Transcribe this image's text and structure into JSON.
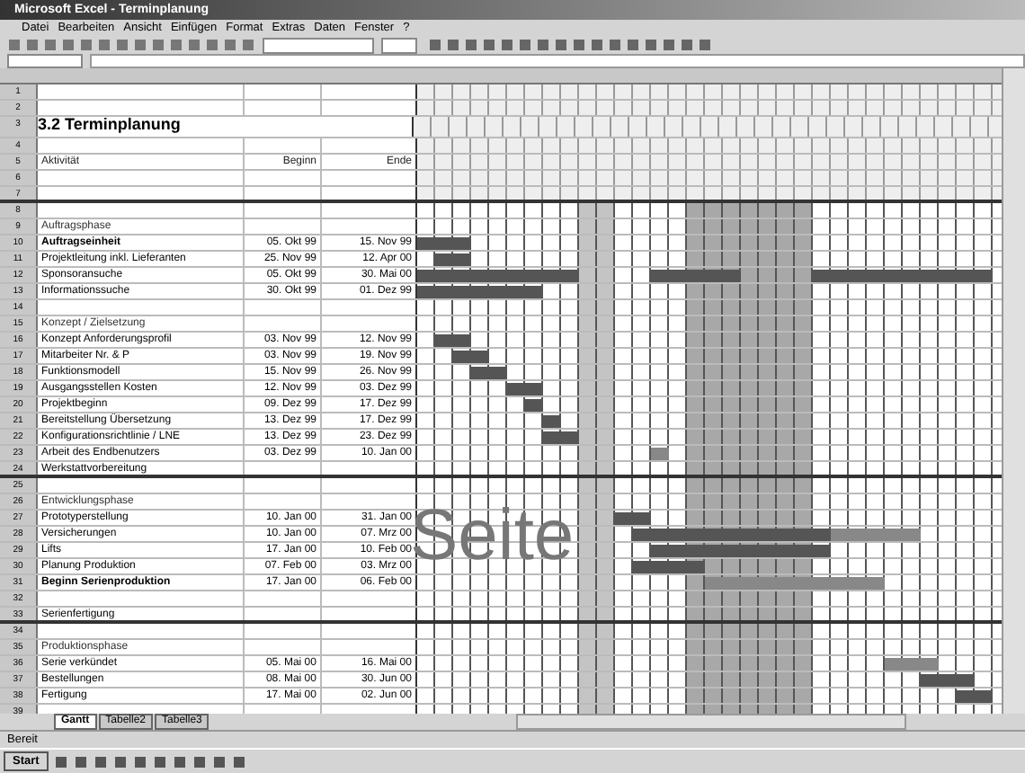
{
  "window": {
    "title": "Microsoft Excel - Terminplanung"
  },
  "menu": [
    "Datei",
    "Bearbeiten",
    "Ansicht",
    "Einfügen",
    "Format",
    "Extras",
    "Daten",
    "Fenster",
    "?"
  ],
  "sheet": {
    "title": "3.2 Terminplanung",
    "columns": [
      "Aktivität",
      "Beginn",
      "Ende"
    ],
    "page_label": "Seite",
    "rows": [
      {
        "num": "1",
        "kind": "blank"
      },
      {
        "num": "2",
        "kind": "blank"
      },
      {
        "num": "3",
        "kind": "title"
      },
      {
        "num": "4",
        "kind": "blank"
      },
      {
        "num": "5",
        "kind": "header"
      },
      {
        "num": "6",
        "kind": "blank"
      },
      {
        "num": "7",
        "kind": "section-end"
      },
      {
        "num": "8",
        "kind": "blank"
      },
      {
        "num": "9",
        "kind": "group",
        "activity": "Auftragsphase"
      },
      {
        "num": "10",
        "kind": "milestone",
        "activity": "Auftragseinheit",
        "start": "05. Okt 99",
        "end": "15. Nov 99"
      },
      {
        "num": "11",
        "kind": "task",
        "activity": "Projektleitung inkl. Lieferanten",
        "start": "25. Nov 99",
        "end": "12. Apr 00"
      },
      {
        "num": "12",
        "kind": "task",
        "activity": "Sponsoransuche",
        "start": "05. Okt 99",
        "end": "30. Mai 00"
      },
      {
        "num": "13",
        "kind": "task",
        "activity": "Informationssuche",
        "start": "30. Okt 99",
        "end": "01. Dez 99"
      },
      {
        "num": "14",
        "kind": "blank"
      },
      {
        "num": "15",
        "kind": "group",
        "activity": "Konzept / Zielsetzung"
      },
      {
        "num": "16",
        "kind": "task",
        "activity": "Konzept Anforderungsprofil",
        "start": "03. Nov 99",
        "end": "12. Nov 99"
      },
      {
        "num": "17",
        "kind": "task",
        "activity": "Mitarbeiter Nr. & P",
        "start": "03. Nov 99",
        "end": "19. Nov 99"
      },
      {
        "num": "18",
        "kind": "task",
        "activity": "Funktionsmodell",
        "start": "15. Nov 99",
        "end": "26. Nov 99"
      },
      {
        "num": "19",
        "kind": "task",
        "activity": "Ausgangsstellen Kosten",
        "start": "12. Nov 99",
        "end": "03. Dez 99"
      },
      {
        "num": "20",
        "kind": "task",
        "activity": "Projektbeginn",
        "start": "09. Dez 99",
        "end": "17. Dez 99"
      },
      {
        "num": "21",
        "kind": "task",
        "activity": "Bereitstellung Übersetzung",
        "start": "13. Dez 99",
        "end": "17. Dez 99"
      },
      {
        "num": "22",
        "kind": "task",
        "activity": "Konfigurationsrichtlinie / LNE",
        "start": "13. Dez 99",
        "end": "23. Dez 99"
      },
      {
        "num": "23",
        "kind": "task",
        "activity": "Arbeit des Endbenutzers",
        "start": "03. Dez 99",
        "end": "10. Jan 00"
      },
      {
        "num": "24",
        "kind": "section-end",
        "activity": "Werkstattvorbereitung"
      },
      {
        "num": "25",
        "kind": "blank"
      },
      {
        "num": "26",
        "kind": "group",
        "activity": "Entwicklungsphase"
      },
      {
        "num": "27",
        "kind": "task",
        "activity": "Prototyperstellung",
        "start": "10. Jan 00",
        "end": "31. Jan 00"
      },
      {
        "num": "28",
        "kind": "task",
        "activity": "Versicherungen",
        "start": "10. Jan 00",
        "end": "07. Mrz 00"
      },
      {
        "num": "29",
        "kind": "task",
        "activity": "Lifts",
        "start": "17. Jan 00",
        "end": "10. Feb 00"
      },
      {
        "num": "30",
        "kind": "task",
        "activity": "Planung Produktion",
        "start": "07. Feb 00",
        "end": "03. Mrz 00"
      },
      {
        "num": "31",
        "kind": "milestone",
        "activity": "Beginn Serienproduktion",
        "start": "17. Jan 00",
        "end": "06. Feb 00"
      },
      {
        "num": "32",
        "kind": "blank"
      },
      {
        "num": "33",
        "kind": "section-end",
        "activity": "Serienfertigung"
      },
      {
        "num": "34",
        "kind": "blank"
      },
      {
        "num": "35",
        "kind": "group",
        "activity": "Produktionsphase"
      },
      {
        "num": "36",
        "kind": "task",
        "activity": "Serie verkündet",
        "start": "05. Mai 00",
        "end": "16. Mai 00"
      },
      {
        "num": "37",
        "kind": "task",
        "activity": "Bestellungen",
        "start": "08. Mai 00",
        "end": "30. Jun 00"
      },
      {
        "num": "38",
        "kind": "task",
        "activity": "Fertigung",
        "start": "17. Mai 00",
        "end": "02. Jun 00"
      },
      {
        "num": "39",
        "kind": "blank"
      }
    ]
  },
  "sheet_tabs": [
    {
      "label": "Gantt",
      "selected": true
    },
    {
      "label": "Tabelle2",
      "selected": false
    },
    {
      "label": "Tabelle3",
      "selected": false
    }
  ],
  "status_bar": "Bereit",
  "taskbar": {
    "start": "Start"
  }
}
